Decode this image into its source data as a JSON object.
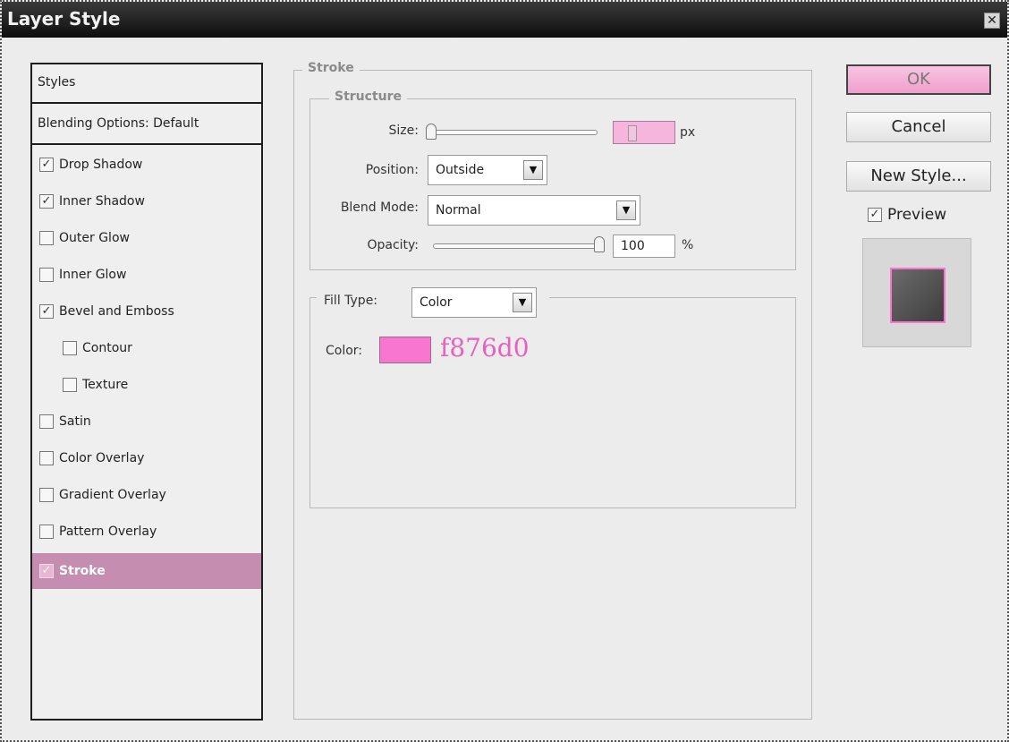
{
  "window": {
    "title": "Layer Style",
    "close_glyph": "✕"
  },
  "styles_panel": {
    "header": "Styles",
    "blending_options": "Blending Options: Default",
    "items": [
      {
        "label": "Drop Shadow",
        "checked": true
      },
      {
        "label": "Inner Shadow",
        "checked": true
      },
      {
        "label": "Outer Glow",
        "checked": false
      },
      {
        "label": "Inner Glow",
        "checked": false
      },
      {
        "label": "Bevel and Emboss",
        "checked": true
      },
      {
        "label": "Contour",
        "checked": false
      },
      {
        "label": "Texture",
        "checked": false
      },
      {
        "label": "Satin",
        "checked": false
      },
      {
        "label": "Color Overlay",
        "checked": false
      },
      {
        "label": "Gradient Overlay",
        "checked": false
      },
      {
        "label": "Pattern Overlay",
        "checked": false
      },
      {
        "label": "Stroke",
        "checked": true
      }
    ],
    "check_mark": "✓"
  },
  "stroke": {
    "title": "Stroke",
    "structure": {
      "title": "Structure",
      "size_label": "Size:",
      "size_value": "1",
      "size_unit": "px",
      "position_label": "Position:",
      "position_value": "Outside",
      "blend_mode_label": "Blend Mode:",
      "blend_mode_value": "Normal",
      "opacity_label": "Opacity:",
      "opacity_value": "100",
      "opacity_unit": "%"
    },
    "fill": {
      "fill_type_label": "Fill Type:",
      "fill_type_value": "Color",
      "color_label": "Color:",
      "color_hex": "f876d0",
      "color_value": "#f876d0"
    }
  },
  "buttons": {
    "ok": "OK",
    "cancel": "Cancel",
    "new_style": "New Style...",
    "preview_label": "Preview",
    "preview_checked": true
  },
  "colors": {
    "accent_pink": "#f876d0",
    "selected_row": "#c58db0",
    "ok_button": "#f3b3d8"
  }
}
